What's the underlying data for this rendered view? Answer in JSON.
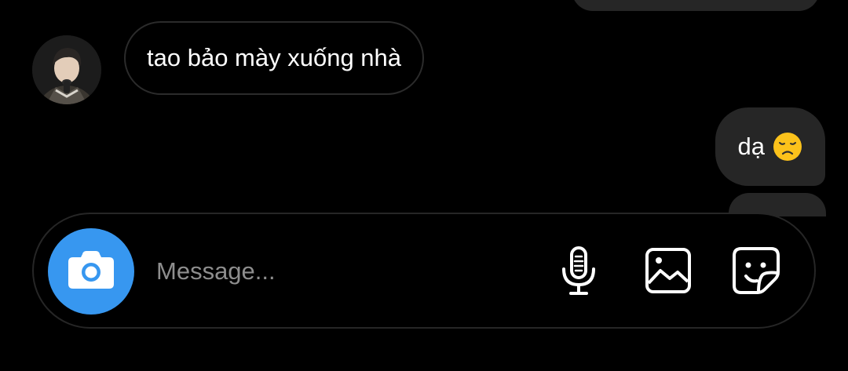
{
  "chat": {
    "messages": [
      {
        "sender": "other",
        "text": "tao bảo mày xuống nhà"
      },
      {
        "sender": "me",
        "text": "dạ",
        "emoji": "disappointed-face"
      }
    ]
  },
  "composer": {
    "placeholder": "Message..."
  },
  "icons": {
    "camera": "camera-icon",
    "mic": "microphone-icon",
    "gallery": "image-icon",
    "sticker": "sticker-icon"
  },
  "colors": {
    "background": "#000000",
    "bubble": "#262626",
    "accent": "#3797f0",
    "placeholder": "#8e8e8e",
    "text": "#ffffff"
  }
}
